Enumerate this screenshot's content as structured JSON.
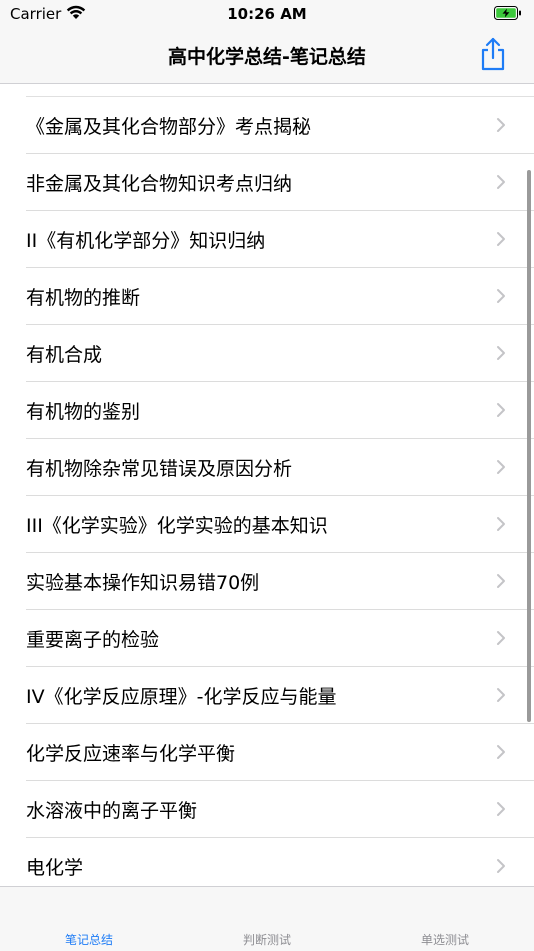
{
  "status_bar": {
    "carrier": "Carrier",
    "time": "10:26 AM"
  },
  "nav": {
    "title": "高中化学总结-笔记总结"
  },
  "list": {
    "items": [
      "《金属及其化合物部分》考点揭秘",
      "非金属及其化合物知识考点归纳",
      "II《有机化学部分》知识归纳",
      "有机物的推断",
      "有机合成",
      "有机物的鉴别",
      "有机物除杂常见错误及原因分析",
      "III《化学实验》化学实验的基本知识",
      "实验基本操作知识易错70例",
      "重要离子的检验",
      "IV《化学反应原理》-化学反应与能量",
      "化学反应速率与化学平衡",
      "水溶液中的离子平衡",
      "电化学"
    ]
  },
  "tabs": [
    {
      "label": "笔记总结",
      "active": true
    },
    {
      "label": "判断测试",
      "active": false
    },
    {
      "label": "单选测试",
      "active": false
    }
  ],
  "colors": {
    "accent": "#1e7cf6",
    "battery": "#3cc83c"
  }
}
